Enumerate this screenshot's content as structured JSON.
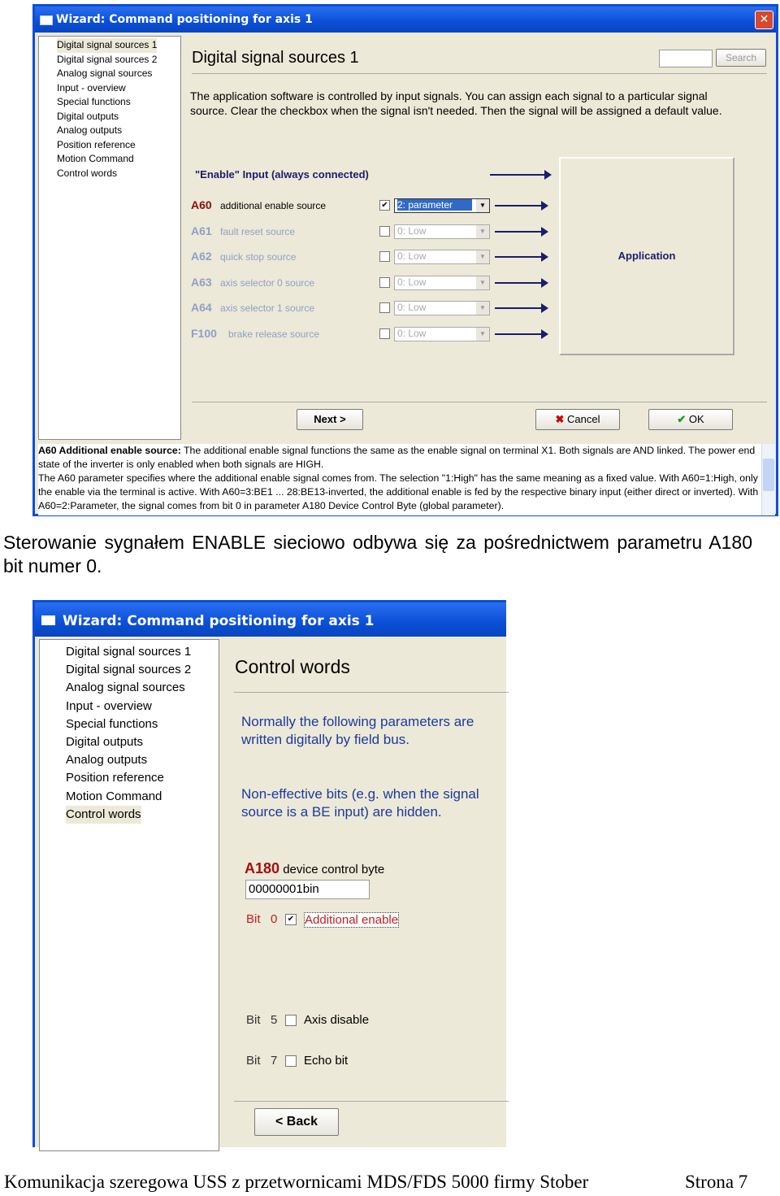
{
  "win1": {
    "title": "Wizard: Command positioning for axis 1",
    "tree": [
      "Digital signal sources 1",
      "Digital signal sources 2",
      "Analog signal sources",
      "Input - overview",
      "Special functions",
      "Digital outputs",
      "Analog outputs",
      "Position reference",
      "Motion Command",
      "Control words"
    ],
    "heading": "Digital signal sources 1",
    "search_label": "Search",
    "intro": "The application software is controlled by input signals. You can assign each signal to a particular signal source. Clear the checkbox when the signal isn't needed. Then the signal will be assigned a default value.",
    "enable_label": "\"Enable\" Input (always connected)",
    "rows": [
      {
        "code": "A60",
        "label": "additional enable source",
        "checked": true,
        "value": "2: parameter"
      },
      {
        "code": "A61",
        "label": "fault reset source",
        "checked": false,
        "value": "0: Low"
      },
      {
        "code": "A62",
        "label": "quick stop source",
        "checked": false,
        "value": "0: Low"
      },
      {
        "code": "A63",
        "label": "axis selector 0 source",
        "checked": false,
        "value": "0: Low"
      },
      {
        "code": "A64",
        "label": "axis selector 1 source",
        "checked": false,
        "value": "0: Low"
      },
      {
        "code": "F100",
        "label": "brake release source",
        "checked": false,
        "value": "0: Low"
      }
    ],
    "application_label": "Application",
    "next": "Next >",
    "cancel": "Cancel",
    "ok": "OK",
    "help": {
      "bold_head": "A60  Additional enable source:",
      "p1": " The additional enable signal functions the same as the enable signal on terminal X1. Both signals are AND linked. The power end state of the inverter is only enabled when both signals are HIGH.",
      "p2": "The A60 parameter specifies where the additional enable signal comes from. The selection \"1:High\" has the same meaning as a fixed value. With A60=1:High, only the enable via the terminal is active. With A60=3:BE1 ... 28:BE13-inverted, the additional enable is fed by the respective binary input (either direct or inverted). With A60=2:Parameter, the signal comes from bit 0 in parameter A180 Device Control Byte (global parameter)."
    }
  },
  "caption": "Sterowanie sygnałem ENABLE sieciowo odbywa się za pośrednictwem parametru A180 bit numer 0.",
  "win2": {
    "title": "Wizard: Command positioning for axis 1",
    "selected": "Control words",
    "heading": "Control words",
    "p1": "Normally the following parameters are written digitally by field bus.",
    "p2": "Non-effective bits (e.g. when the signal source is a BE input) are hidden.",
    "param_code": "A180",
    "param_label": "device control byte",
    "param_value": "00000001bin",
    "bits": [
      {
        "bit": "Bit   0",
        "checked": true,
        "label": "Additional enable"
      },
      {
        "bit": "Bit   5",
        "checked": false,
        "label": "Axis disable"
      },
      {
        "bit": "Bit   7",
        "checked": false,
        "label": "Echo bit"
      }
    ],
    "back": "< Back"
  },
  "footer": {
    "left": "Komunikacja szeregowa USS z przetwornicami MDS/FDS 5000 firmy Stober",
    "right": "Strona 7"
  }
}
